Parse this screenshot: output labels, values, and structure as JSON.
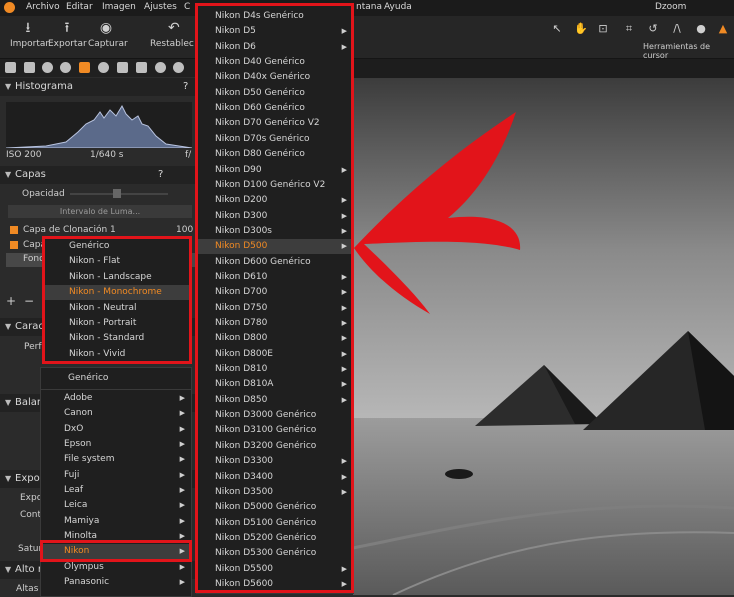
{
  "app": {
    "title": "Dzoom"
  },
  "menubar": {
    "items": [
      "Archivo",
      "Editar",
      "Imagen",
      "Ajustes",
      "C",
      "ntana",
      "Ayuda"
    ]
  },
  "toolbar": {
    "buttons": [
      {
        "label": "Importar",
        "icon": "import-icon"
      },
      {
        "label": "Exportar",
        "icon": "export-icon"
      },
      {
        "label": "Capturar",
        "icon": "camera-icon"
      },
      {
        "label": "Restablec",
        "icon": "reset-icon"
      }
    ],
    "cursor_tools_label": "Herramientas de cursor"
  },
  "panel": {
    "histogram": {
      "title": "Histograma",
      "help": "?",
      "iso": "ISO 200",
      "shutter": "1/640 s",
      "aperture": "f/"
    },
    "layers": {
      "title": "Capas",
      "help": "?",
      "opacity_label": "Opacidad",
      "luma_button": "Intervalo de Luma...",
      "rows": [
        {
          "name": "Capa de Clonación 1",
          "value": "100"
        },
        {
          "name": "Capa",
          "value": ""
        },
        {
          "name": "Fond",
          "value": ""
        }
      ]
    },
    "partial_labels": {
      "carac": "Carac",
      "perf": "Perf",
      "balance": "Balanc",
      "expos_head": "Expos",
      "expos": "Expos",
      "contr": "Contr",
      "satur": "Satur",
      "alto_ra": "Alto ra",
      "altas": "Altas L"
    }
  },
  "curve_submenu": {
    "items": [
      "Genérico",
      "Nikon - Flat",
      "Nikon - Landscape",
      "Nikon - Monochrome",
      "Nikon - Neutral",
      "Nikon - Portrait",
      "Nikon - Standard",
      "Nikon - Vivid"
    ],
    "highlighted": "Nikon - Monochrome"
  },
  "brand_menu": {
    "items": [
      {
        "label": "Genérico",
        "arrow": false
      },
      {
        "label": "Adobe",
        "arrow": true
      },
      {
        "label": "Canon",
        "arrow": true
      },
      {
        "label": "DxO",
        "arrow": true
      },
      {
        "label": "Epson",
        "arrow": true
      },
      {
        "label": "File system",
        "arrow": true
      },
      {
        "label": "Fuji",
        "arrow": true
      },
      {
        "label": "Leaf",
        "arrow": true
      },
      {
        "label": "Leica",
        "arrow": true
      },
      {
        "label": "Mamiya",
        "arrow": true
      },
      {
        "label": "Minolta",
        "arrow": true
      },
      {
        "label": "Nikon",
        "arrow": true
      },
      {
        "label": "Olympus",
        "arrow": true
      },
      {
        "label": "Panasonic",
        "arrow": true
      }
    ],
    "highlighted": "Nikon"
  },
  "camera_menu": {
    "items": [
      {
        "label": "Nikon D4s Genérico",
        "arrow": false
      },
      {
        "label": "Nikon D5",
        "arrow": true
      },
      {
        "label": "Nikon D6",
        "arrow": true
      },
      {
        "label": "Nikon D40 Genérico",
        "arrow": false
      },
      {
        "label": "Nikon D40x Genérico",
        "arrow": false
      },
      {
        "label": "Nikon D50 Genérico",
        "arrow": false
      },
      {
        "label": "Nikon D60 Genérico",
        "arrow": false
      },
      {
        "label": "Nikon D70 Genérico V2",
        "arrow": false
      },
      {
        "label": "Nikon D70s Genérico",
        "arrow": false
      },
      {
        "label": "Nikon D80 Genérico",
        "arrow": false
      },
      {
        "label": "Nikon D90",
        "arrow": true
      },
      {
        "label": "Nikon D100 Genérico V2",
        "arrow": false
      },
      {
        "label": "Nikon D200",
        "arrow": true
      },
      {
        "label": "Nikon D300",
        "arrow": true
      },
      {
        "label": "Nikon D300s",
        "arrow": true
      },
      {
        "label": "Nikon D500",
        "arrow": true
      },
      {
        "label": "Nikon D600 Genérico",
        "arrow": false
      },
      {
        "label": "Nikon D610",
        "arrow": true
      },
      {
        "label": "Nikon D700",
        "arrow": true
      },
      {
        "label": "Nikon D750",
        "arrow": true
      },
      {
        "label": "Nikon D780",
        "arrow": true
      },
      {
        "label": "Nikon D800",
        "arrow": true
      },
      {
        "label": "Nikon D800E",
        "arrow": true
      },
      {
        "label": "Nikon D810",
        "arrow": true
      },
      {
        "label": "Nikon D810A",
        "arrow": true
      },
      {
        "label": "Nikon D850",
        "arrow": true
      },
      {
        "label": "Nikon D3000 Genérico",
        "arrow": false
      },
      {
        "label": "Nikon D3100 Genérico",
        "arrow": false
      },
      {
        "label": "Nikon D3200 Genérico",
        "arrow": false
      },
      {
        "label": "Nikon D3300",
        "arrow": true
      },
      {
        "label": "Nikon D3400",
        "arrow": true
      },
      {
        "label": "Nikon D3500",
        "arrow": true
      },
      {
        "label": "Nikon D5000 Genérico",
        "arrow": false
      },
      {
        "label": "Nikon D5100 Genérico",
        "arrow": false
      },
      {
        "label": "Nikon D5200 Genérico",
        "arrow": false
      },
      {
        "label": "Nikon D5300 Genérico",
        "arrow": false
      },
      {
        "label": "Nikon D5500",
        "arrow": true
      },
      {
        "label": "Nikon D5600",
        "arrow": true
      }
    ],
    "highlighted": "Nikon D500"
  },
  "colors": {
    "accent": "#f08a24",
    "annotation_red": "#e2141a"
  }
}
